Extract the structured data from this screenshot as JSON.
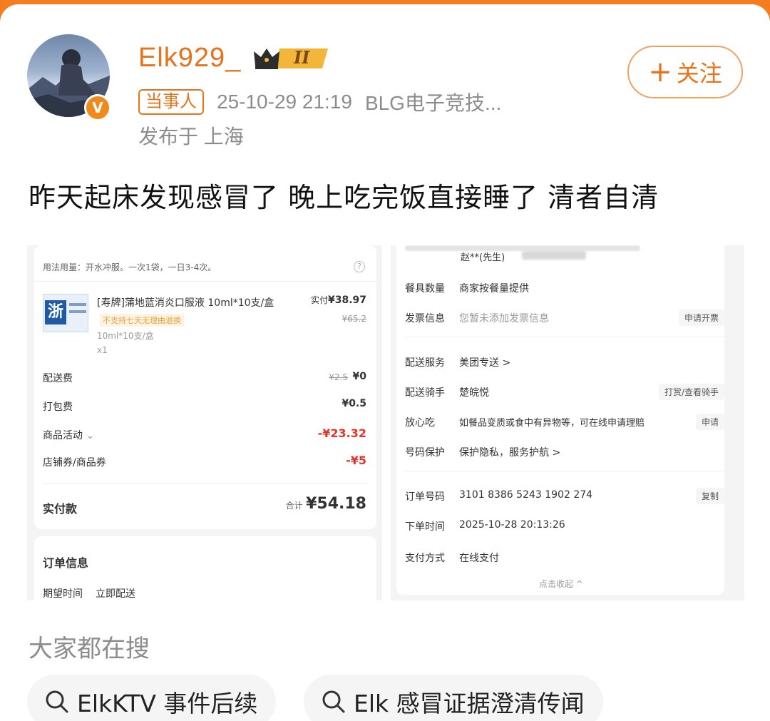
{
  "post": {
    "username": "Elk929_",
    "vip_level": "II",
    "tag": "当事人",
    "timestamp": "25-10-29 21:19",
    "source": "BLG电子竞技...",
    "location": "发布于 上海",
    "follow_label": "关注",
    "follow_plus": "+",
    "text": "昨天起床发现感冒了 晚上吃完饭直接睡了  清者自清",
    "avatar_badge": "V"
  },
  "left_shot": {
    "usage": "用法用量：开水冲服。一次1袋，一日3-4次。",
    "product_icon_text": "浙",
    "product_name": "[寿牌]蒲地蓝消炎口服液 10ml*10支/盒",
    "paid_label": "实付",
    "paid_price": "¥38.97",
    "orig_price": "¥65.2",
    "no_return": "不支持七天无理由退换",
    "spec": "10ml*10支/盒",
    "qty": "x1",
    "rows": [
      {
        "label": "配送费",
        "old": "¥2.5",
        "value": "¥0"
      },
      {
        "label": "打包费",
        "old": "",
        "value": "¥0.5"
      },
      {
        "label": "商品活动",
        "old": "",
        "value": "-¥23.32"
      },
      {
        "label": "店铺券/商品券",
        "old": "",
        "value": "-¥5"
      }
    ],
    "total_label": "实付款",
    "total_prefix": "合计",
    "total_value": "¥54.18",
    "order_info_title": "订单信息",
    "expect_label": "期望时间",
    "expect_value": "立即配送"
  },
  "right_shot": {
    "recipient": "赵**(先生)",
    "rows": [
      {
        "label": "餐具数量",
        "value": "商家按餐量提供",
        "btn": ""
      },
      {
        "label": "发票信息",
        "value": "您暂未添加发票信息",
        "btn": "申请开票"
      },
      {
        "label": "配送服务",
        "value": "美团专送 >",
        "btn": ""
      },
      {
        "label": "配送骑手",
        "value": "楚皖悦",
        "btn": "打赏/查看骑手"
      },
      {
        "label": "放心吃",
        "value": "如餐品变质或食中有异物等，可在线申请理赔",
        "btn": "申请"
      },
      {
        "label": "号码保护",
        "value": "保护隐私，服务护航 >",
        "btn": ""
      },
      {
        "label": "订单号码",
        "value": "3101 8386 5243 1902 274",
        "btn": "复制"
      },
      {
        "label": "下单时间",
        "value": "2025-10-28 20:13:26",
        "btn": ""
      },
      {
        "label": "支付方式",
        "value": "在线支付",
        "btn": ""
      }
    ],
    "collapse": "点击收起 ^"
  },
  "search": {
    "title": "大家都在搜",
    "chips": [
      "ElkKTV 事件后续",
      "Elk 感冒证据澄清传闻"
    ]
  },
  "colors": {
    "accent": "#e8731a",
    "price_red": "#e5332a",
    "top_bar": "#f57c1f"
  }
}
